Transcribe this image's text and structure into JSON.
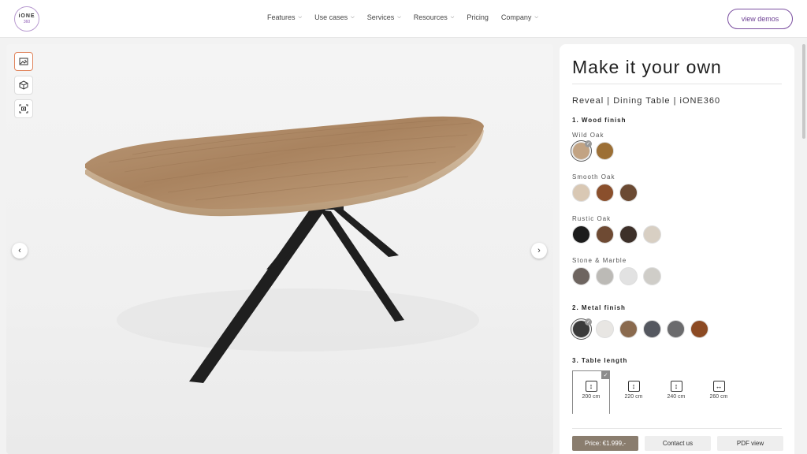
{
  "header": {
    "logo_top": "iONE",
    "logo_bottom": "360",
    "nav": [
      "Features",
      "Use cases",
      "Services",
      "Resources",
      "Pricing",
      "Company"
    ],
    "demo_button": "view demos"
  },
  "viewer": {
    "tools": [
      "image-icon",
      "cube-icon",
      "camera-icon"
    ],
    "prev": "‹",
    "next": "›"
  },
  "panel": {
    "title": "Make it your own",
    "subtitle": "Reveal | Dining Table | iONE360",
    "sections": {
      "wood": "1.  Wood finish",
      "metal": "2.  Metal finish",
      "length": "3.  Table length"
    },
    "groups": {
      "wild": "Wild Oak",
      "smooth": "Smooth Oak",
      "rustic": "Rustic Oak",
      "stone": "Stone & Marble"
    },
    "swatches": {
      "wild": [
        "#c2a383",
        "#9c6f35"
      ],
      "smooth": [
        "#d9c8b4",
        "#8a4f2c",
        "#6b4a33"
      ],
      "rustic": [
        "#1c1c1c",
        "#6e4a33",
        "#3d3029",
        "#d8cfc3"
      ],
      "stone": [
        "#6e6560",
        "#bcbab6",
        "#e2e2e2",
        "#cfcdc8"
      ],
      "metal": [
        "#3b3b3b",
        "#e8e6e3",
        "#8a6a4e",
        "#555860",
        "#6b6b6d",
        "#8c4a23"
      ]
    },
    "lengths": [
      "200 cm",
      "220 cm",
      "240 cm",
      "260 cm"
    ],
    "price_button": "Price: €1.999,-",
    "contact_button": "Contact us",
    "pdf_button": "PDF view"
  }
}
